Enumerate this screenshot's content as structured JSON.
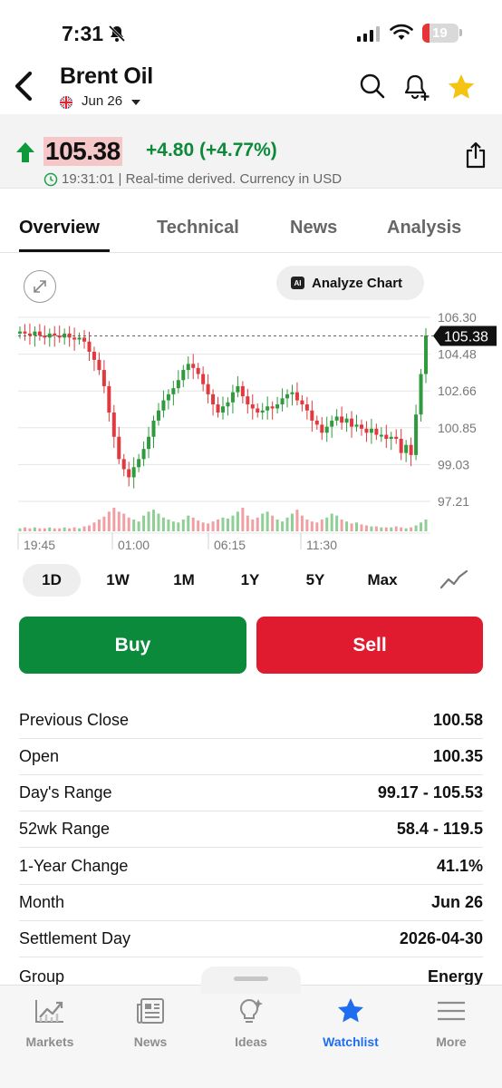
{
  "status": {
    "time": "7:31",
    "battery": "19"
  },
  "header": {
    "title": "Brent Oil",
    "contract": "Jun 26"
  },
  "quote": {
    "price": "105.38",
    "change": "+4.80 (+4.77%)",
    "timestamp": "19:31:01 | Real-time derived. Currency in USD"
  },
  "tabs": [
    {
      "label": "Overview"
    },
    {
      "label": "Technical"
    },
    {
      "label": "News"
    },
    {
      "label": "Analysis"
    }
  ],
  "analyze_label": "Analyze Chart",
  "ai_badge": "AI",
  "chart_data": {
    "type": "candlestick",
    "y_ticks": [
      "106.30",
      "104.48",
      "102.66",
      "100.85",
      "99.03",
      "97.21"
    ],
    "ylim": [
      97.21,
      106.3
    ],
    "x_ticks": [
      "19:45",
      "01:00",
      "06:15",
      "11:30"
    ],
    "last_price_label": "105.38",
    "last_price": 105.38,
    "colors": {
      "up": "#2f9a3e",
      "down": "#e0393e",
      "vol_up": "#8fcf95",
      "vol_down": "#f0a0a3"
    },
    "closes": [
      105.6,
      105.5,
      105.4,
      105.6,
      105.4,
      105.3,
      105.5,
      105.4,
      105.3,
      105.5,
      105.3,
      105.2,
      105.3,
      105.1,
      104.6,
      104.2,
      103.7,
      102.9,
      101.6,
      100.4,
      99.3,
      98.8,
      98.4,
      98.9,
      99.3,
      99.8,
      100.4,
      101.2,
      101.7,
      102.2,
      102.5,
      102.8,
      103.2,
      103.7,
      104.0,
      103.8,
      103.5,
      103.0,
      102.5,
      102.0,
      101.6,
      101.9,
      102.1,
      102.6,
      102.9,
      102.4,
      102.0,
      101.8,
      101.6,
      101.7,
      101.9,
      101.8,
      102.0,
      102.3,
      102.5,
      102.6,
      102.2,
      102.0,
      101.7,
      101.2,
      101.0,
      100.6,
      100.9,
      101.2,
      101.4,
      101.1,
      101.3,
      100.9,
      101.0,
      100.8,
      100.6,
      100.8,
      100.5,
      100.5,
      100.3,
      100.4,
      100.3,
      99.6,
      100.0,
      99.5,
      101.5,
      103.5,
      105.4
    ],
    "volumes": [
      3,
      4,
      3,
      4,
      3,
      3,
      4,
      3,
      3,
      4,
      3,
      4,
      3,
      5,
      6,
      9,
      12,
      15,
      20,
      24,
      20,
      18,
      14,
      12,
      10,
      16,
      20,
      22,
      18,
      14,
      12,
      10,
      9,
      12,
      16,
      14,
      11,
      9,
      8,
      10,
      12,
      14,
      13,
      16,
      20,
      24,
      16,
      12,
      14,
      18,
      20,
      16,
      12,
      10,
      14,
      18,
      22,
      16,
      12,
      10,
      9,
      12,
      14,
      18,
      16,
      12,
      10,
      8,
      9,
      7,
      6,
      5,
      5,
      4,
      4,
      4,
      5,
      4,
      3,
      4,
      6,
      9,
      12
    ],
    "start_open": 105.5
  },
  "periods": [
    "1D",
    "1W",
    "1M",
    "1Y",
    "5Y",
    "Max"
  ],
  "actions": {
    "buy": "Buy",
    "sell": "Sell"
  },
  "stats": [
    {
      "label": "Previous Close",
      "value": "100.58"
    },
    {
      "label": "Open",
      "value": "100.35"
    },
    {
      "label": "Day's Range",
      "value": "99.17 - 105.53"
    },
    {
      "label": "52wk Range",
      "value": "58.4 - 119.5"
    },
    {
      "label": "1-Year Change",
      "value": "41.1%"
    },
    {
      "label": "Month",
      "value": "Jun 26"
    },
    {
      "label": "Settlement Day",
      "value": "2026-04-30"
    },
    {
      "label": "Group",
      "value": "Energy"
    }
  ],
  "nav": [
    {
      "label": "Markets",
      "icon": "markets-icon"
    },
    {
      "label": "News",
      "icon": "news-icon"
    },
    {
      "label": "Ideas",
      "icon": "ideas-icon"
    },
    {
      "label": "Watchlist",
      "icon": "star-icon"
    },
    {
      "label": "More",
      "icon": "menu-icon"
    }
  ],
  "accent": "#1f6ef0"
}
